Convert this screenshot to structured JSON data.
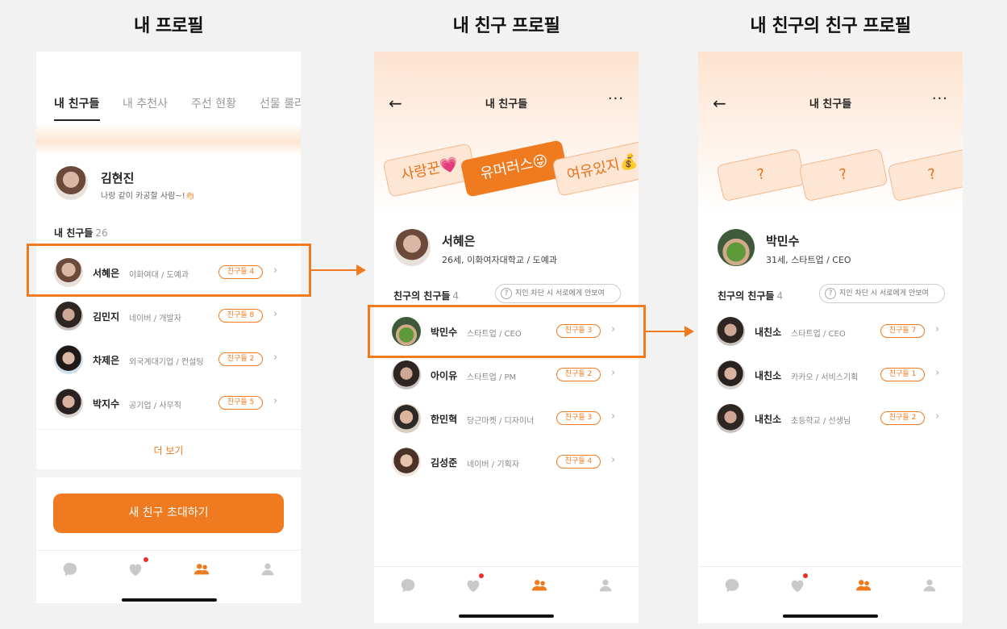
{
  "titles": {
    "my_profile": "내 프로필",
    "friend_profile": "내 친구 프로필",
    "fof_profile": "내 친구의 친구 프로필"
  },
  "colors": {
    "accent": "#f07a1f",
    "badge_dot": "#e8302a"
  },
  "p1": {
    "tabs": [
      "내 친구들",
      "내 추천사",
      "주선 현황",
      "선물 룰러"
    ],
    "me": {
      "name": "김현진",
      "status": "나랑 같이 카공할 사람~!👏🏻"
    },
    "section_title": "내 친구들",
    "section_count": "26",
    "friends": [
      {
        "name": "서혜은",
        "info": "이화여대 / 도예과",
        "badge": "친구들 4"
      },
      {
        "name": "김민지",
        "info": "네이버 / 개발자",
        "badge": "친구들 8"
      },
      {
        "name": "차제은",
        "info": "외국계대기업 / 컨설팅",
        "badge": "친구들 2"
      },
      {
        "name": "박지수",
        "info": "공기업 / 사무직",
        "badge": "친구들 5"
      }
    ],
    "more_label": "더 보기",
    "invite_label": "새 친구 초대하기"
  },
  "p2": {
    "top_title": "내 친구들",
    "tags": [
      "사랑꾼💗",
      "유머러스😜",
      "여유있지💰"
    ],
    "profile": {
      "name": "서혜은",
      "info": "26세, 이화여자대학교 / 도예과"
    },
    "section_title": "친구의 친구들",
    "section_count": "4",
    "hint": "지인 차단 시 서로에게 안보여",
    "hint_icon": "?",
    "friends": [
      {
        "name": "박민수",
        "info": "스타트업 / CEO",
        "badge": "친구들 3"
      },
      {
        "name": "아이유",
        "info": "스타트업 / PM",
        "badge": "친구들 2"
      },
      {
        "name": "한민혁",
        "info": "당근마켓 / 디자이너",
        "badge": "친구들 3"
      },
      {
        "name": "김성준",
        "info": "네이버 / 기획자",
        "badge": "친구들 4"
      }
    ]
  },
  "p3": {
    "top_title": "내 친구들",
    "cards": [
      "?",
      "?",
      "?"
    ],
    "profile": {
      "name": "박민수",
      "info": "31세, 스타트업 / CEO"
    },
    "section_title": "친구의 친구들",
    "section_count": "4",
    "hint": "지인 차단 시 서로에게 안보여",
    "hint_icon": "?",
    "friends": [
      {
        "name": "내친소",
        "info": "스타트업 / CEO",
        "badge": "친구들 7"
      },
      {
        "name": "내친소",
        "info": "카카오 / 서비스기획",
        "badge": "친구들 1"
      },
      {
        "name": "내친소",
        "info": "초등학교 / 선생님",
        "badge": "친구들 2"
      }
    ]
  },
  "icons": {
    "back": "←",
    "more": "···",
    "chevron": "›"
  }
}
